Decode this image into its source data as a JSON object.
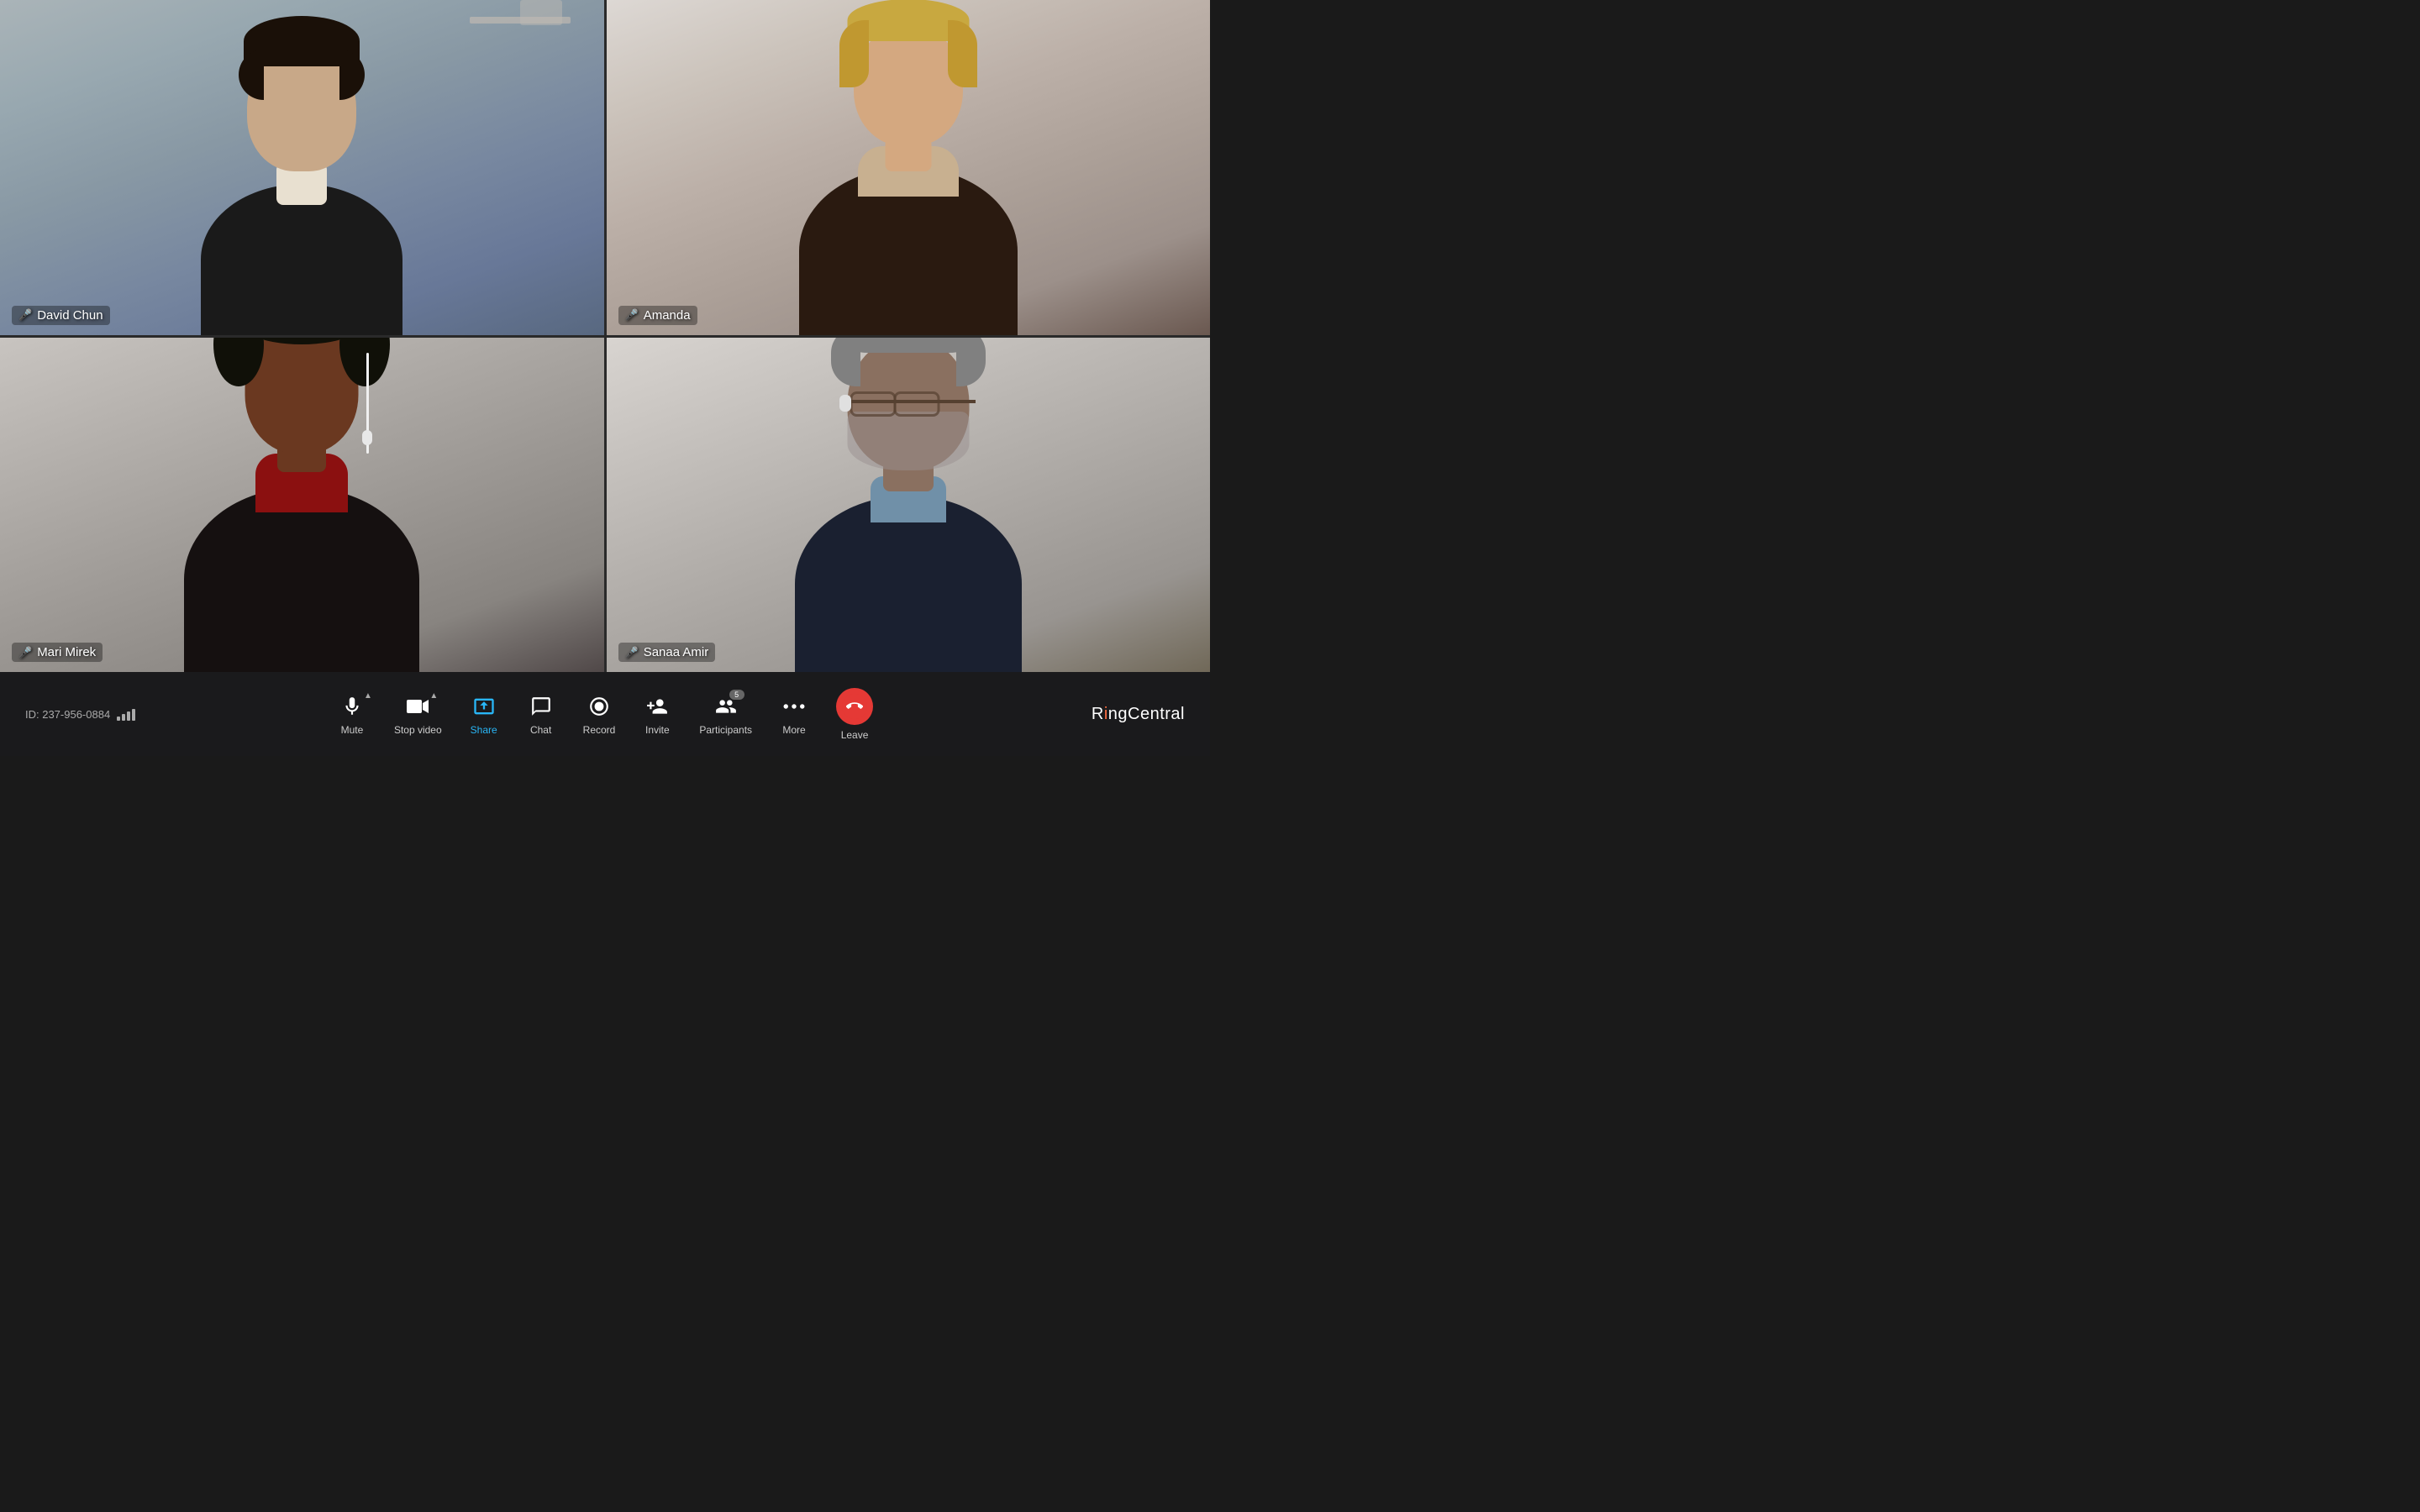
{
  "meeting": {
    "id": "ID: 237-956-0884"
  },
  "participants": [
    {
      "name": "David Chun",
      "position": "top-left",
      "active_speaker": true,
      "mic_status": "active",
      "bg_color_top": "#c8cac8",
      "bg_color_bottom": "#909898"
    },
    {
      "name": "Amanda",
      "position": "top-right",
      "active_speaker": false,
      "mic_status": "muted",
      "bg_color_top": "#e0dbd8",
      "bg_color_bottom": "#8a7a72"
    },
    {
      "name": "Mari Mirek",
      "position": "bottom-left",
      "active_speaker": false,
      "mic_status": "active",
      "bg_color_top": "#ccc8c4",
      "bg_color_bottom": "#504844"
    },
    {
      "name": "Sanaa Amir",
      "position": "bottom-right",
      "active_speaker": false,
      "mic_status": "active",
      "bg_color_top": "#d4d0cc",
      "bg_color_bottom": "#706860"
    }
  ],
  "toolbar": {
    "buttons": [
      {
        "id": "mute",
        "label": "Mute",
        "has_chevron": true
      },
      {
        "id": "stop-video",
        "label": "Stop video",
        "has_chevron": true
      },
      {
        "id": "share",
        "label": "Share",
        "has_chevron": false,
        "highlighted": true
      },
      {
        "id": "chat",
        "label": "Chat",
        "has_chevron": false
      },
      {
        "id": "record",
        "label": "Record",
        "has_chevron": false
      },
      {
        "id": "invite",
        "label": "Invite",
        "has_chevron": false
      },
      {
        "id": "participants",
        "label": "Participants",
        "has_chevron": false,
        "badge": "5"
      },
      {
        "id": "more",
        "label": "More",
        "has_chevron": false
      },
      {
        "id": "leave",
        "label": "Leave",
        "has_chevron": false
      }
    ]
  },
  "brand": {
    "name": "RingCentral",
    "ring_color": "#ff7043"
  }
}
